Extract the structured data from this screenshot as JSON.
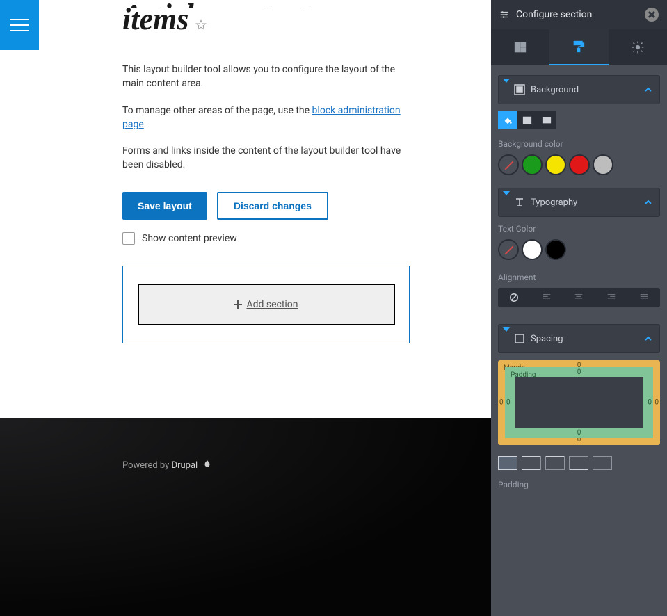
{
  "page": {
    "title_line1_cut": "Article content",
    "title_line2": "items",
    "help1": "This layout builder tool allows you to configure the layout of the main content area.",
    "help2_prefix": "To manage other areas of the page, use the ",
    "help2_link": "block administration page",
    "help2_suffix": ".",
    "help3": "Forms and links inside the content of the layout builder tool have been disabled."
  },
  "actions": {
    "save": "Save layout",
    "discard": "Discard changes",
    "preview_label": "Show content preview",
    "add_section": "Add section"
  },
  "footer": {
    "prefix": "Powered by ",
    "link": "Drupal"
  },
  "sidebar": {
    "header_title": "Configure section",
    "tabs": [
      "layout-tab",
      "style-tab",
      "settings-tab"
    ],
    "background": {
      "head": "Background",
      "types": [
        "paint",
        "image",
        "video"
      ],
      "color_label": "Background color",
      "colors": [
        "none",
        "#1b9b1b",
        "#f5e400",
        "#e01818",
        "#bdbdbd"
      ]
    },
    "typography": {
      "head": "Typography",
      "text_color_label": "Text Color",
      "colors": [
        "none",
        "#ffffff",
        "#000000"
      ],
      "alignment_label": "Alignment",
      "alignments": [
        "none",
        "left",
        "center",
        "right",
        "justify"
      ]
    },
    "spacing": {
      "head": "Spacing",
      "margin_label": "Margin",
      "padding_inner_label": "Padding",
      "margin": {
        "top": "0",
        "right": "0",
        "bottom": "0",
        "left": "0"
      },
      "padding": {
        "top": "0",
        "right": "0",
        "bottom": "0",
        "left": "0"
      },
      "variants": [
        "all",
        "top-bottom",
        "top",
        "bottom",
        "none"
      ],
      "padding_label": "Padding"
    }
  }
}
